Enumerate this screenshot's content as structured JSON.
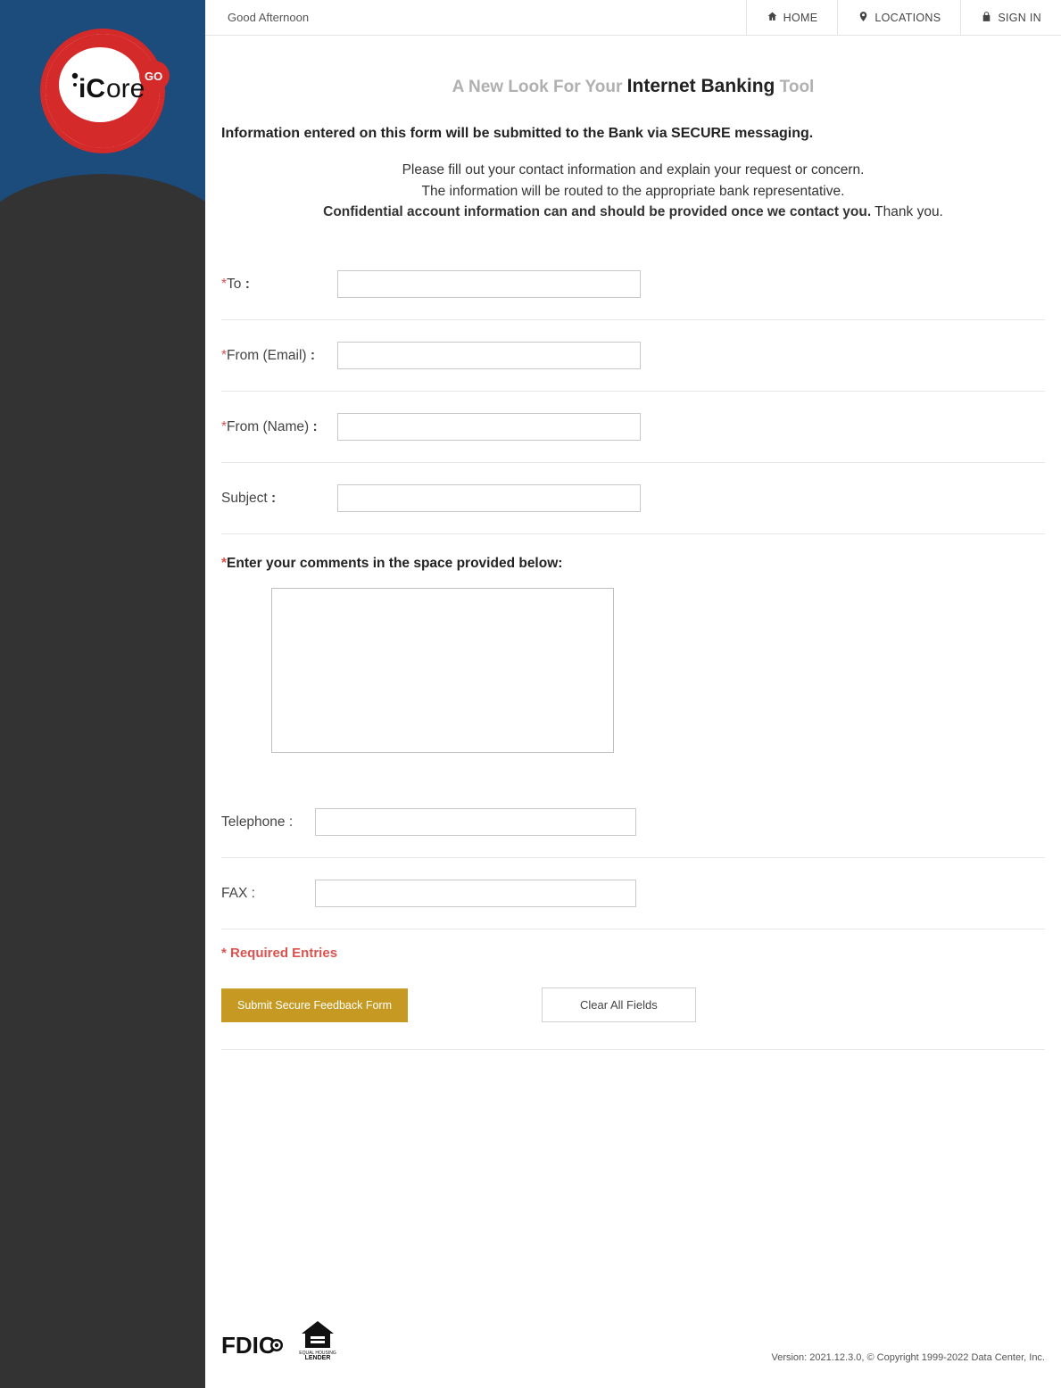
{
  "topbar": {
    "greeting": "Good Afternoon",
    "home": "HOME",
    "locations": "LOCATIONS",
    "signin": "SIGN IN"
  },
  "hero": {
    "lead": "A New Look For Your ",
    "emph": "Internet Banking",
    "trail": " Tool"
  },
  "notice": "Information entered on this form will be submitted to the Bank via SECURE messaging.",
  "instructions": {
    "line1": "Please fill out your contact information and explain your request or concern.",
    "line2": "The information will be routed to the appropriate bank representative.",
    "bold": "Confidential account information can and should be provided once we contact you.",
    "thanks": " Thank you."
  },
  "form": {
    "to_label": "To",
    "from_email_label": "From (Email)",
    "from_name_label": "From (Name)",
    "subject_label": "Subject",
    "comments_label": "Enter your comments in the space provided below:",
    "telephone_label": "Telephone :",
    "fax_label": "FAX :",
    "required_note": "* Required Entries",
    "submit": "Submit Secure Feedback Form",
    "clear": "Clear All Fields",
    "values": {
      "to": "",
      "from_email": "",
      "from_name": "",
      "subject": "",
      "comments": "",
      "telephone": "",
      "fax": ""
    }
  },
  "footer": {
    "version": "Version: 2021.12.3.0, © Copyright 1999-2022 Data Center, Inc."
  },
  "logo": {
    "brand": "iCore",
    "sub": "GO"
  },
  "badges": {
    "fdic": "FDIC",
    "ehl": "EQUAL HOUSING",
    "ehl2": "LENDER"
  }
}
